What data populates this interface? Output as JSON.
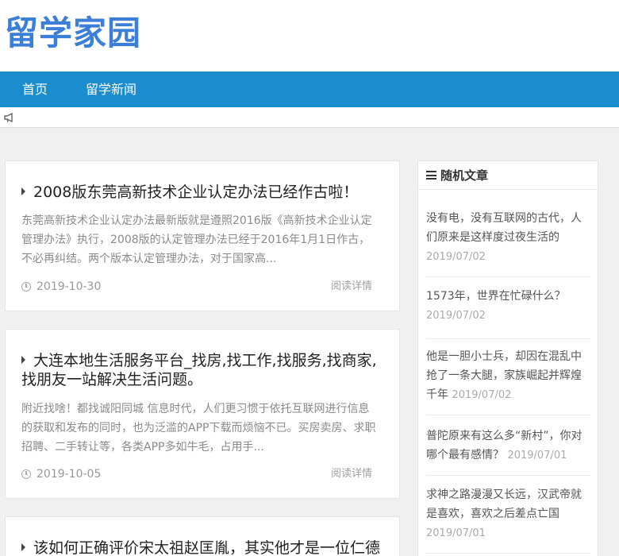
{
  "site": {
    "logo": "留学家园"
  },
  "nav": {
    "items": [
      {
        "label": "首页"
      },
      {
        "label": "留学新闻"
      }
    ]
  },
  "posts": [
    {
      "title": "2008版东莞高新技术企业认定办法已经作古啦！",
      "excerpt": "东莞高新技术企业认定办法最新版就是遵照2016版《高新技术企业认定管理办法》执行，2008版的认定管理办法已经于2016年1月1日作古，不必再纠结。两个版本认定管理办法，对于国家高...",
      "date": "2019-10-30",
      "read_more": "阅读详情"
    },
    {
      "title": "大连本地生活服务平台_找房,找工作,找服务,找商家,找朋友一站解决生活问题。",
      "excerpt": "附近找啥！都找诚阳同城 信息时代，人们更习惯于依托互联网进行信息的获取和发布的同时，也为泛滥的APP下载而烦恼不已。买房卖房、求职招聘、二手转让等，各类APP多如牛毛，占用手...",
      "date": "2019-10-05",
      "read_more": "阅读详情"
    },
    {
      "title": "该如何正确评价宋太祖赵匡胤，其实他才是一位仁德"
    }
  ],
  "sidebar": {
    "title": "随机文章",
    "items": [
      {
        "title": "没有电，没有互联网的古代，人们原来是这样度过夜生活的",
        "date": "2019/07/02"
      },
      {
        "title": "1573年，世界在忙碌什么？",
        "date": "2019/07/02"
      },
      {
        "title": "他是一胆小士兵，却因在混乱中抢了一条大腿，家族崛起并辉煌千年",
        "date": "2019/07/02"
      },
      {
        "title": "普陀原来有这么多“新村”，你对哪个最有感情？",
        "date": "2019/07/01"
      },
      {
        "title": "求神之路漫漫又长远，汉武帝就是喜欢，喜欢之后差点亡国",
        "date": "2019/07/01"
      }
    ]
  },
  "colors": {
    "brand": "#3c7fd8",
    "nav_bg": "#1b8ccd",
    "page_bg": "#f0f0f0"
  },
  "icons": {
    "notice": "megaphone-icon",
    "date": "clock-icon",
    "sidebar": "menu-icon"
  }
}
